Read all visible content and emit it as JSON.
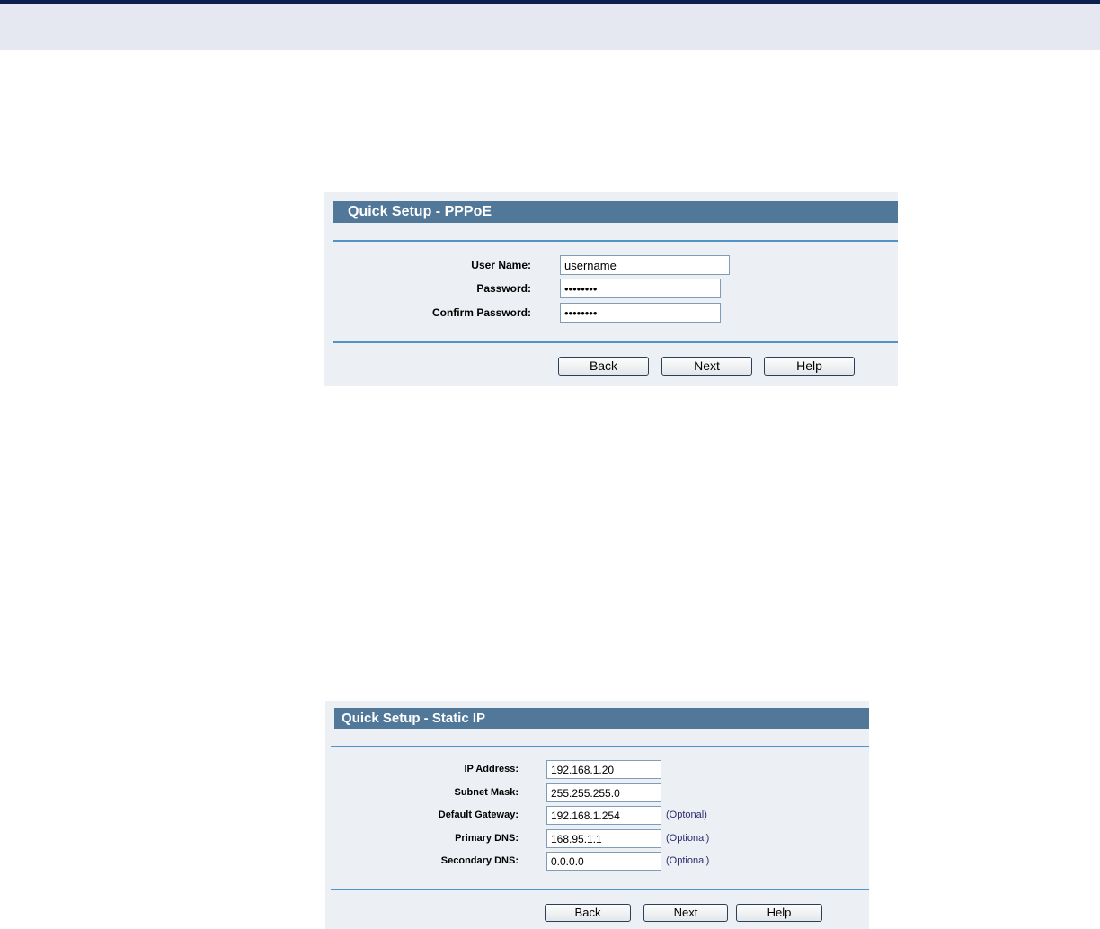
{
  "pppoe_panel": {
    "title": "Quick Setup - PPPoE",
    "fields": {
      "username": {
        "label": "User Name:",
        "value": "username"
      },
      "password": {
        "label": "Password:",
        "value": "••••••••"
      },
      "confirm_password": {
        "label": "Confirm Password:",
        "value": "••••••••"
      }
    },
    "buttons": {
      "back": "Back",
      "next": "Next",
      "help": "Help"
    }
  },
  "static_ip_panel": {
    "title": "Quick Setup - Static IP",
    "fields": {
      "ip_address": {
        "label": "IP Address:",
        "value": "192.168.1.20"
      },
      "subnet_mask": {
        "label": "Subnet Mask:",
        "value": "255.255.255.0"
      },
      "default_gateway": {
        "label": "Default Gateway:",
        "value": "192.168.1.254",
        "note": "(Optonal)"
      },
      "primary_dns": {
        "label": "Primary DNS:",
        "value": "168.95.1.1",
        "note": "(Optional)"
      },
      "secondary_dns": {
        "label": "Secondary DNS:",
        "value": "0.0.0.0",
        "note": "(Optional)"
      }
    },
    "buttons": {
      "back": "Back",
      "next": "Next",
      "help": "Help"
    }
  },
  "colors": {
    "header_rule": "#0d1f4d",
    "header_band": "#e5e8f1",
    "panel_background": "#ecf0f4",
    "title_bar": "#517799",
    "divider": "#4f94c4",
    "optional_text": "#2e2a6e"
  }
}
